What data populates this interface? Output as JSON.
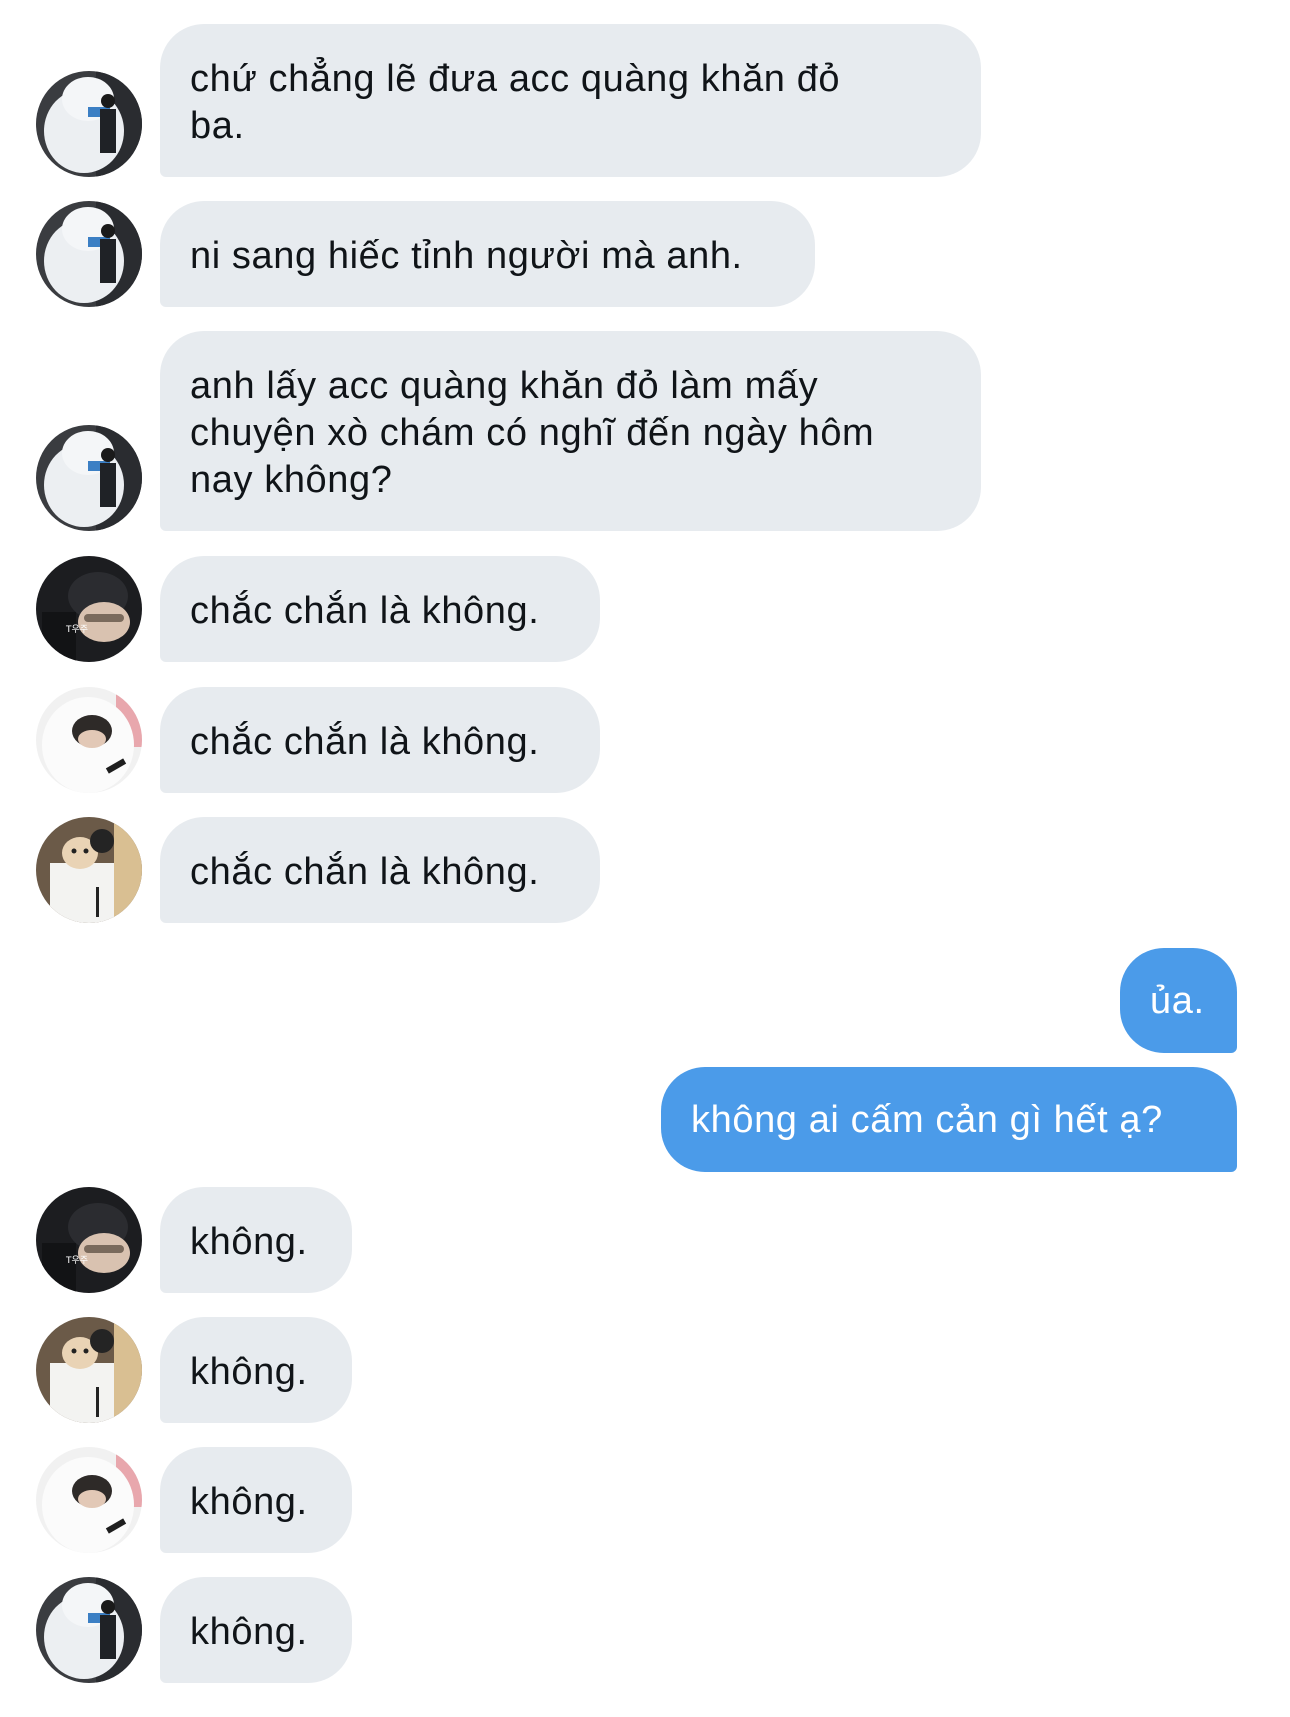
{
  "conversation": {
    "messages": [
      {
        "sender": "mascot",
        "direction": "incoming",
        "text": "chứ chẳng lẽ đưa acc quàng khăn đỏ\nba."
      },
      {
        "sender": "mascot",
        "direction": "incoming",
        "text": "ni sang hiếc tỉnh người mà anh."
      },
      {
        "sender": "mascot",
        "direction": "incoming",
        "text": "anh lấy acc quàng khăn đỏ làm mấy\nchuyện xò chám có nghĩ đến ngày hôm\nnay không?"
      },
      {
        "sender": "dark-hoodie",
        "direction": "incoming",
        "text": "chắc chắn là không."
      },
      {
        "sender": "white-hood",
        "direction": "incoming",
        "text": "chắc chắn là không."
      },
      {
        "sender": "dog-hug",
        "direction": "incoming",
        "text": "chắc chắn là không."
      },
      {
        "sender": "me",
        "direction": "outgoing",
        "text": "ủa."
      },
      {
        "sender": "me",
        "direction": "outgoing",
        "text": "không ai cấm cản gì hết ạ?"
      },
      {
        "sender": "dark-hoodie",
        "direction": "incoming",
        "text": "không."
      },
      {
        "sender": "dog-hug",
        "direction": "incoming",
        "text": "không."
      },
      {
        "sender": "white-hood",
        "direction": "incoming",
        "text": "không."
      },
      {
        "sender": "mascot",
        "direction": "incoming",
        "text": "không."
      }
    ]
  },
  "colors": {
    "incoming_bubble": "#e7ebef",
    "incoming_text": "#101418",
    "outgoing_bubble": "#4b9be9",
    "outgoing_text": "#ffffff",
    "background": "#ffffff"
  },
  "icons": {
    "avatar_mascot": "avatar-mascot-icon",
    "avatar_dark_hoodie": "avatar-dark-hoodie-icon",
    "avatar_white_hood": "avatar-white-hood-icon",
    "avatar_dog_hug": "avatar-dog-hug-icon"
  }
}
